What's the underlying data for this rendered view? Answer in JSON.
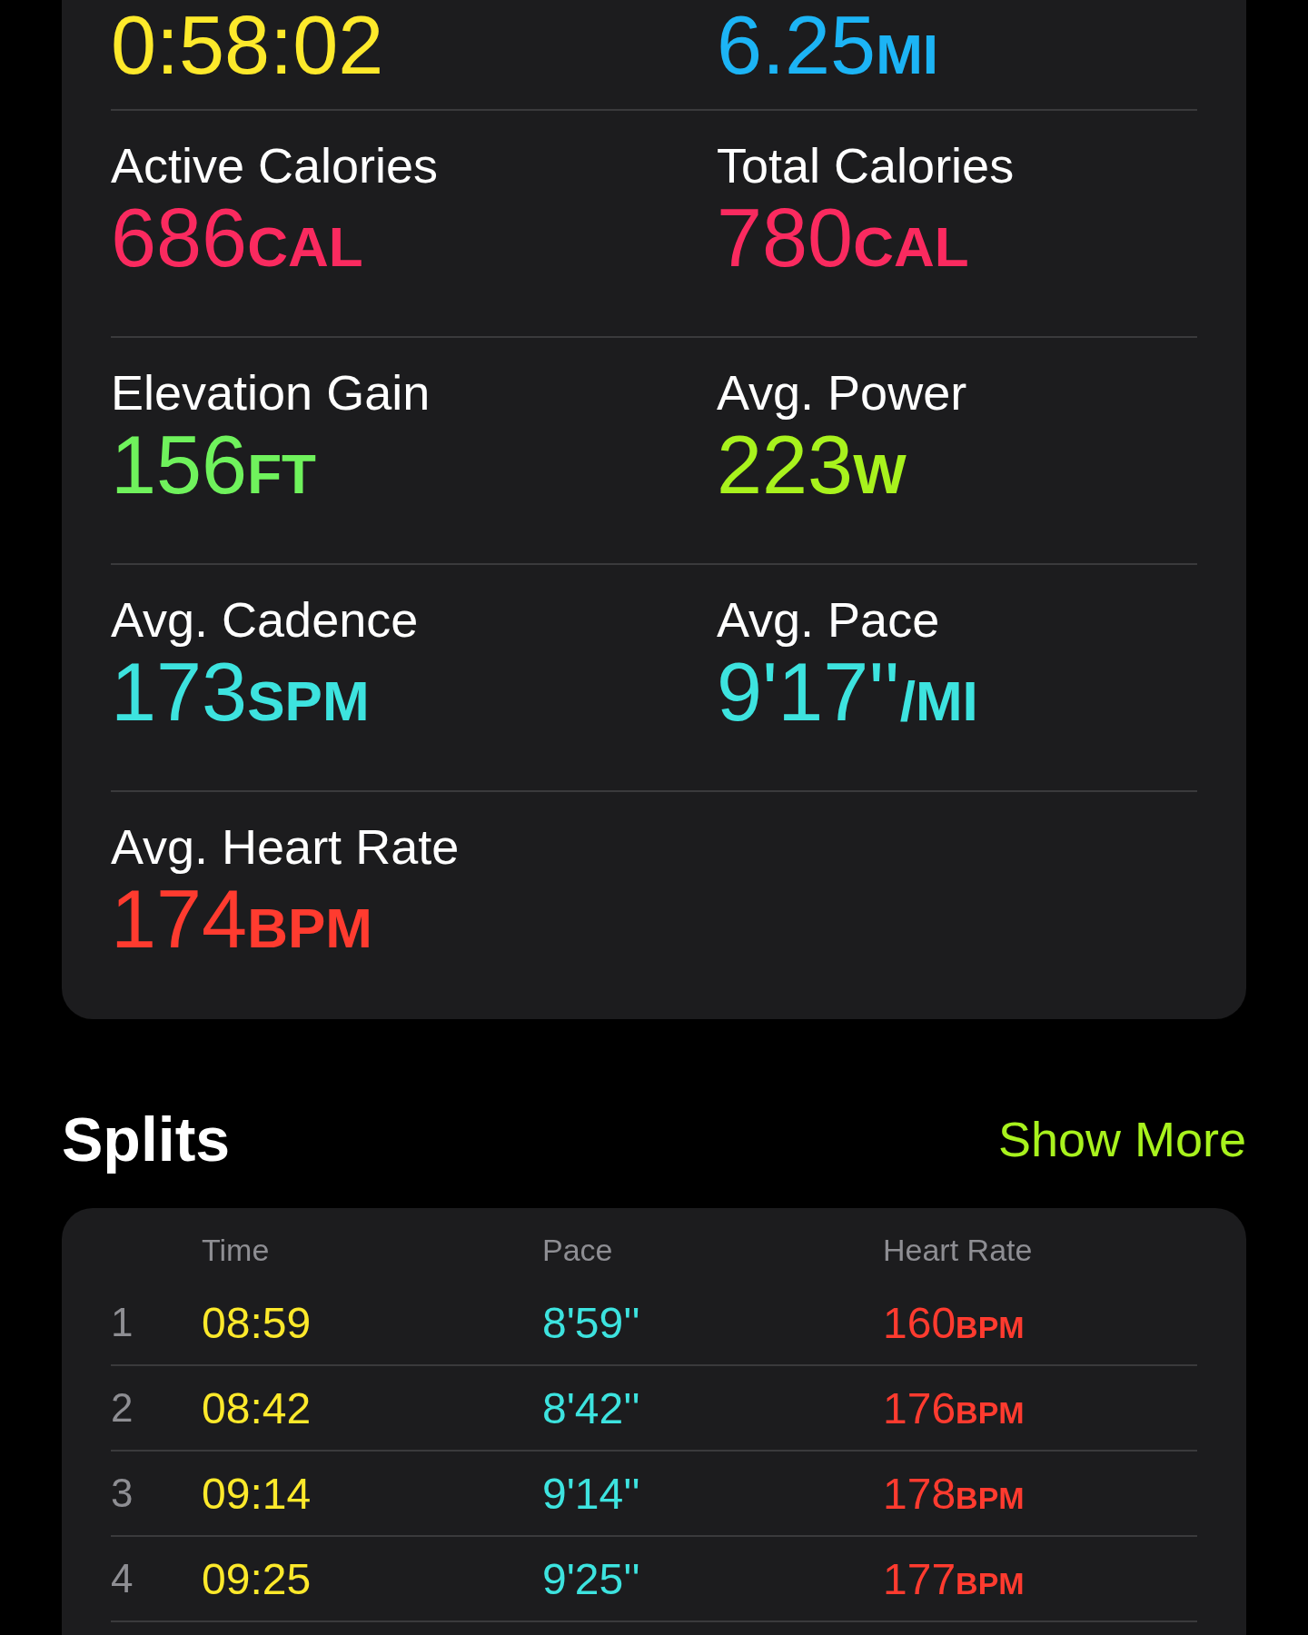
{
  "summary": {
    "metrics": [
      {
        "value": "0:58:02",
        "color": "#fde92b"
      },
      {
        "value": "6.25",
        "unit": "MI",
        "color": "#1cb4f5"
      },
      {
        "label": "Active Calories",
        "value": "686",
        "unit": "CAL",
        "color": "#fa2a5f"
      },
      {
        "label": "Total Calories",
        "value": "780",
        "unit": "CAL",
        "color": "#fa2a5f"
      },
      {
        "label": "Elevation Gain",
        "value": "156",
        "unit": "FT",
        "color": "#6ff25c"
      },
      {
        "label": "Avg. Power",
        "value": "223",
        "unit": "W",
        "color": "#a8f21d"
      },
      {
        "label": "Avg. Cadence",
        "value": "173",
        "unit": "SPM",
        "color": "#3de3df"
      },
      {
        "label": "Avg. Pace",
        "value": "9'17''",
        "unit": "/MI",
        "color": "#3de3df"
      },
      {
        "label": "Avg. Heart Rate",
        "value": "174",
        "unit": "BPM",
        "color": "#ff3b2f"
      }
    ]
  },
  "splits": {
    "title": "Splits",
    "show_more": "Show More",
    "columns": [
      "Time",
      "Pace",
      "Heart Rate"
    ],
    "rows": [
      {
        "index": "1",
        "time": "08:59",
        "pace": "8'59''",
        "heart_rate": "160",
        "unit": "BPM"
      },
      {
        "index": "2",
        "time": "08:42",
        "pace": "8'42''",
        "heart_rate": "176",
        "unit": "BPM"
      },
      {
        "index": "3",
        "time": "09:14",
        "pace": "9'14''",
        "heart_rate": "178",
        "unit": "BPM"
      },
      {
        "index": "4",
        "time": "09:25",
        "pace": "9'25''",
        "heart_rate": "177",
        "unit": "BPM"
      }
    ]
  }
}
